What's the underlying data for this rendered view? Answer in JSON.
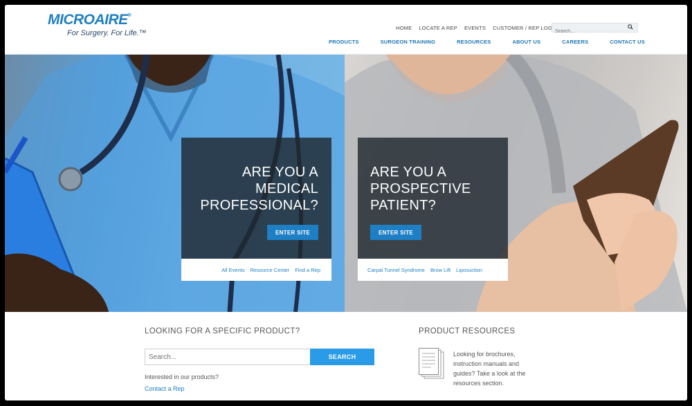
{
  "brand": {
    "logo_text": "MICROAIRE",
    "tagline": "For Surgery. For Life.™",
    "primary_color": "#1f7fc0",
    "accent_color": "#2a9be6"
  },
  "utility_nav": [
    "HOME",
    "LOCATE A REP",
    "EVENTS",
    "CUSTOMER / REP LOGIN"
  ],
  "header_search": {
    "placeholder": "Search..."
  },
  "main_nav": [
    "PRODUCTS",
    "SURGEON TRAINING",
    "RESOURCES",
    "ABOUT US",
    "CAREERS",
    "CONTACT US"
  ],
  "hero": {
    "medical": {
      "line1": "ARE YOU A",
      "line2": "MEDICAL",
      "line3": "PROFESSIONAL?",
      "button": "ENTER SITE",
      "links": [
        "All Events",
        "Resource Center",
        "Find a Rep"
      ]
    },
    "patient": {
      "line1": "ARE YOU A",
      "line2": "PROSPECTIVE",
      "line3": "PATIENT?",
      "button": "ENTER SITE",
      "links": [
        "Carpal Tunnel Syndrome",
        "Brow Lift",
        "Liposuction"
      ]
    }
  },
  "product_search": {
    "title": "LOOKING FOR A SPECIFIC PRODUCT?",
    "placeholder": "Search...",
    "button": "SEARCH",
    "prompt": "Interested in our products?",
    "contact_link": "Contact a Rep"
  },
  "product_resources": {
    "title": "PRODUCT RESOURCES",
    "text": "Looking for brochures, instruction manuals and guides? Take a look at the resources section."
  }
}
